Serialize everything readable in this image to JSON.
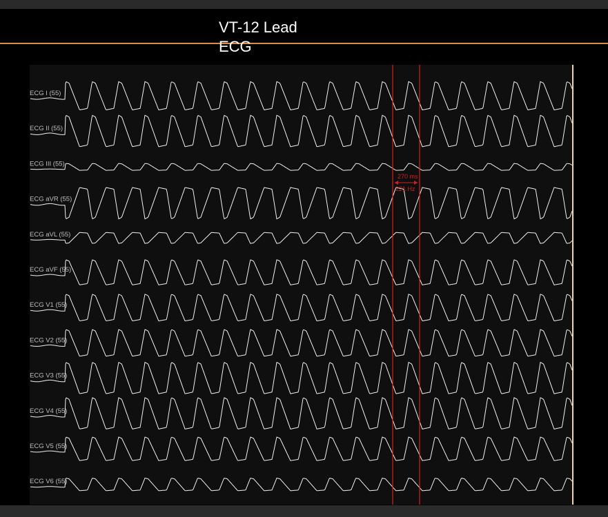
{
  "title": "VT-12 Lead ECG",
  "colors": {
    "background": "#000000",
    "plot_background": "#0f0f0f",
    "trace": "#f2f2f2",
    "accent": "#e08a46",
    "caliper": "#d42020",
    "end_marker": "#f0d9a0"
  },
  "caliper": {
    "interval": "270 ms",
    "rate": "221 Hz"
  },
  "leads": [
    {
      "id": "I",
      "label": "ECG I (55)",
      "amp": 0.9,
      "invert": false
    },
    {
      "id": "II",
      "label": "ECG II (55)",
      "amp": 1.0,
      "invert": false
    },
    {
      "id": "III",
      "label": "ECG III (55)",
      "amp": 0.22,
      "invert": false
    },
    {
      "id": "aVR",
      "label": "ECG aVR (55)",
      "amp": 1.0,
      "invert": true
    },
    {
      "id": "aVL",
      "label": "ECG aVL (55)",
      "amp": 0.35,
      "invert": true
    },
    {
      "id": "aVF",
      "label": "ECG aVF (55)",
      "amp": 0.8,
      "invert": false
    },
    {
      "id": "V1",
      "label": "ECG V1 (55)",
      "amp": 0.85,
      "invert": false
    },
    {
      "id": "V2",
      "label": "ECG V2 (55)",
      "amp": 0.85,
      "invert": false
    },
    {
      "id": "V3",
      "label": "ECG V3 (55)",
      "amp": 1.0,
      "invert": false
    },
    {
      "id": "V4",
      "label": "ECG V4 (55)",
      "amp": 1.0,
      "invert": false
    },
    {
      "id": "V5",
      "label": "ECG V5 (55)",
      "amp": 0.75,
      "invert": false
    },
    {
      "id": "V6",
      "label": "ECG V6 (55)",
      "amp": 0.4,
      "invert": false
    }
  ]
}
